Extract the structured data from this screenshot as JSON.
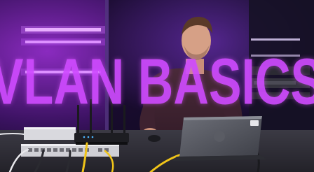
{
  "thumbnail": {
    "title_text": "VLAN BASICS",
    "title_color": "#cf4bff",
    "background_light_color": "#a52fd6",
    "laptop_badge": "DELL"
  },
  "scene_elements": [
    "presenter",
    "laptop",
    "computer-mouse",
    "network-switch",
    "wireless-router",
    "ethernet-cables",
    "neon-light-bars",
    "equipment-rack"
  ]
}
